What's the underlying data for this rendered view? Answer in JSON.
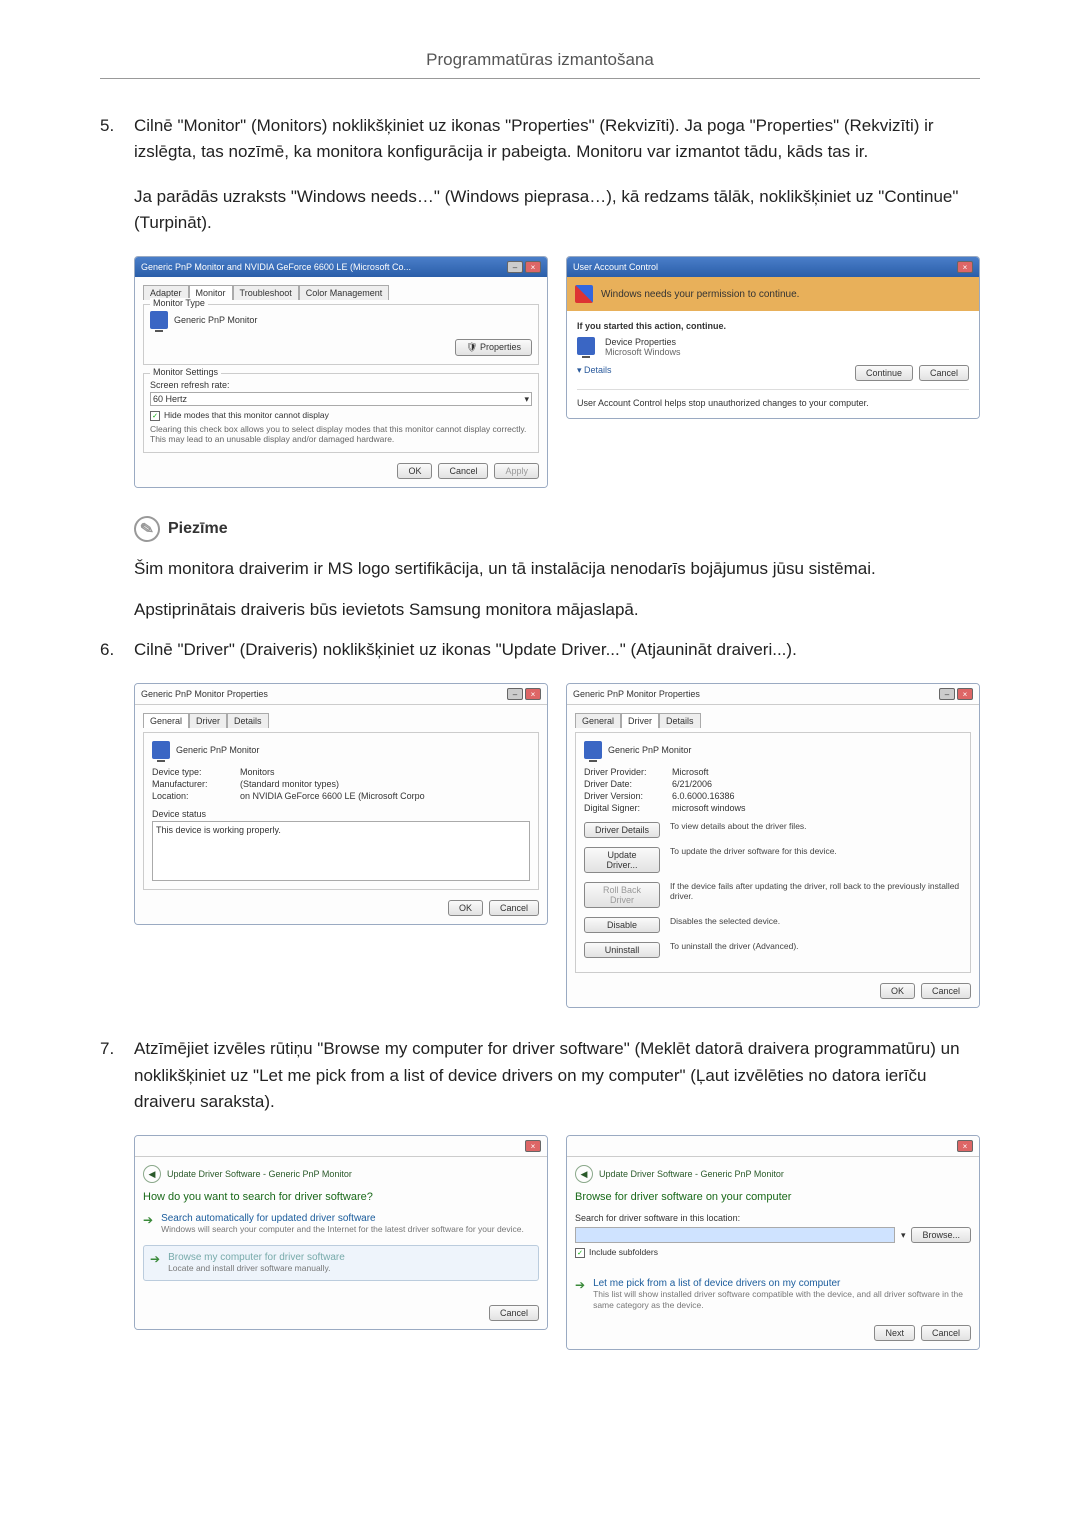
{
  "header": "Programmatūras izmantošana",
  "steps": {
    "s5_num": "5.",
    "s5_text": "Cilnē \"Monitor\" (Monitors) noklikšķiniet uz ikonas \"Properties\" (Rekvizīti). Ja poga \"Properties\" (Rekvizīti) ir izslēgta, tas nozīmē, ka monitora konfigurācija ir pabeigta. Monitoru var izmantot tādu, kāds tas ir.",
    "s5_para2": "Ja parādās uzraksts \"Windows needs…\" (Windows pieprasa…), kā redzams tālāk, noklikšķiniet uz \"Continue\" (Turpināt).",
    "s6_num": "6.",
    "s6_text": "Cilnē \"Driver\" (Draiveris) noklikšķiniet uz ikonas \"Update Driver...\" (Atjaunināt draiveri...).",
    "s7_num": "7.",
    "s7_text": "Atzīmējiet izvēles rūtiņu \"Browse my computer for driver software\" (Meklēt datorā draivera programmatūru) un noklikšķiniet uz \"Let me pick from a list of device drivers on my computer\" (Ļaut izvēlēties no datora ierīču draiveru saraksta)."
  },
  "note": {
    "title": "Piezīme",
    "p1": "Šim monitora draiverim ir MS logo sertifikācija, un tā instalācija nenodarīs bojājumus jūsu sistēmai.",
    "p2": "Apstiprinātais draiveris būs ievietots Samsung monitora mājaslapā."
  },
  "fig1": {
    "title": "Generic PnP Monitor and NVIDIA GeForce 6600 LE (Microsoft Co...",
    "tabs": {
      "adapter": "Adapter",
      "monitor": "Monitor",
      "trouble": "Troubleshoot",
      "color": "Color Management"
    },
    "g1": "Monitor Type",
    "g1_txt": "Generic PnP Monitor",
    "props": "Properties",
    "g2": "Monitor Settings",
    "rate_lab": "Screen refresh rate:",
    "rate_val": "60 Hertz",
    "hide_cb": "Hide modes that this monitor cannot display",
    "hide_desc": "Clearing this check box allows you to select display modes that this monitor cannot display correctly. This may lead to an unusable display and/or damaged hardware.",
    "ok": "OK",
    "cancel": "Cancel",
    "apply": "Apply"
  },
  "fig2": {
    "title": "User Account Control",
    "bar": "Windows needs your permission to continue.",
    "started": "If you started this action, continue.",
    "item": "Device Properties",
    "item2": "Microsoft Windows",
    "details": "Details",
    "cont": "Continue",
    "cancel": "Cancel",
    "foot": "User Account Control helps stop unauthorized changes to your computer."
  },
  "fig3": {
    "title": "Generic PnP Monitor Properties",
    "tabs": {
      "general": "General",
      "driver": "Driver",
      "details": "Details"
    },
    "dev": "Generic PnP Monitor",
    "kv": {
      "type_k": "Device type:",
      "type_v": "Monitors",
      "manu_k": "Manufacturer:",
      "manu_v": "(Standard monitor types)",
      "loc_k": "Location:",
      "loc_v": "on NVIDIA GeForce 6600 LE (Microsoft Corpo"
    },
    "status_lab": "Device status",
    "status_txt": "This device is working properly.",
    "ok": "OK",
    "cancel": "Cancel"
  },
  "fig4": {
    "title": "Generic PnP Monitor Properties",
    "tabs": {
      "general": "General",
      "driver": "Driver",
      "details": "Details"
    },
    "dev": "Generic PnP Monitor",
    "kv": {
      "prov_k": "Driver Provider:",
      "prov_v": "Microsoft",
      "date_k": "Driver Date:",
      "date_v": "6/21/2006",
      "ver_k": "Driver Version:",
      "ver_v": "6.0.6000.16386",
      "sig_k": "Digital Signer:",
      "sig_v": "microsoft windows"
    },
    "btns": {
      "details": "Driver Details",
      "details_d": "To view details about the driver files.",
      "update": "Update Driver...",
      "update_d": "To update the driver software for this device.",
      "roll": "Roll Back Driver",
      "roll_d": "If the device fails after updating the driver, roll back to the previously installed driver.",
      "disable": "Disable",
      "disable_d": "Disables the selected device.",
      "uninstall": "Uninstall",
      "uninstall_d": "To uninstall the driver (Advanced)."
    },
    "ok": "OK",
    "cancel": "Cancel"
  },
  "fig5": {
    "crumb": "Update Driver Software - Generic PnP Monitor",
    "head": "How do you want to search for driver software?",
    "o1_t": "Search automatically for updated driver software",
    "o1_d": "Windows will search your computer and the Internet for the latest driver software for your device.",
    "o2_t": "Browse my computer for driver software",
    "o2_d": "Locate and install driver software manually.",
    "cancel": "Cancel"
  },
  "fig6": {
    "crumb": "Update Driver Software - Generic PnP Monitor",
    "head": "Browse for driver software on your computer",
    "search_lab": "Search for driver software in this location:",
    "browse": "Browse...",
    "include": "Include subfolders",
    "o1_t": "Let me pick from a list of device drivers on my computer",
    "o1_d": "This list will show installed driver software compatible with the device, and all driver software in the same category as the device.",
    "next": "Next",
    "cancel": "Cancel"
  }
}
